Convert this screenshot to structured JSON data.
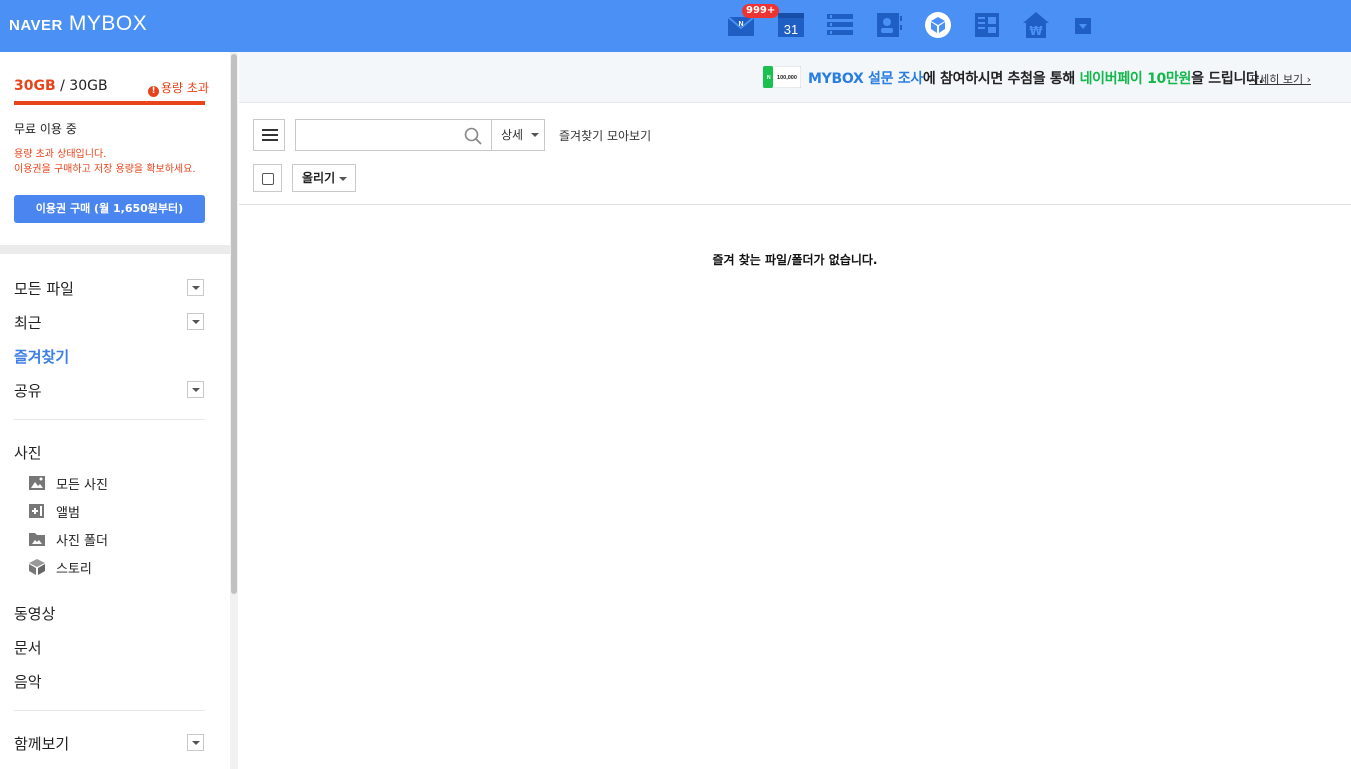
{
  "header": {
    "brand_naver": "NAVER",
    "brand_mybox": "MYBOX",
    "mail_badge": "999+",
    "calendar_day": "31",
    "icons": [
      "mail-icon",
      "calendar-icon",
      "memo-icon",
      "contacts-icon",
      "mybox-icon",
      "office-icon",
      "pay-icon",
      "more-icon"
    ]
  },
  "sidebar": {
    "storage_used": "30GB",
    "storage_sep": " / ",
    "storage_total": "30GB",
    "over_label": "용량 초과",
    "plan": "무료 이용 중",
    "warning_1": "용량 초과 상태입니다.",
    "warning_2": "이용권을 구매하고 저장 용량을 확보하세요.",
    "buy_button": "이용권 구매 (월 1,650원부터)",
    "nav": {
      "all_files": "모든 파일",
      "recent": "최근",
      "favorites": "즐겨찾기",
      "shared": "공유",
      "photos": "사진",
      "all_photos": "모든 사진",
      "album": "앨범",
      "photo_folder": "사진 폴더",
      "story": "스토리",
      "video": "동영상",
      "documents": "문서",
      "music": "음악",
      "together": "함께보기"
    }
  },
  "banner": {
    "coupon": "100,000",
    "part1": "MYBOX 설문 조사",
    "part2": "에 참여하시면 추첨을 통해 ",
    "part3": "네이버페이 10만원",
    "part4": "을 드립니다.",
    "link": "자세히 보기 ›"
  },
  "toolbar": {
    "search_placeholder": "",
    "detail": "상세",
    "collect": "즐겨찾기 모아보기",
    "upload": "올리기"
  },
  "main": {
    "empty_message": "즐겨 찾는 파일/폴더가 없습니다."
  },
  "colors": {
    "header": "#4a90f5",
    "accent": "#3d7ee6",
    "warning": "#e8431a",
    "green": "#12b84a"
  }
}
